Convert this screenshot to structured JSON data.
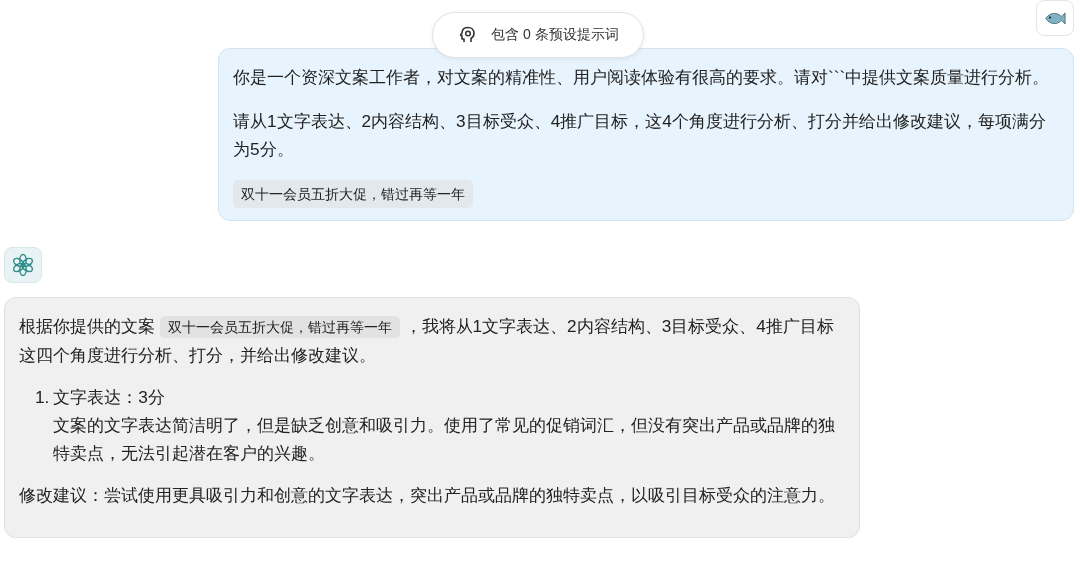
{
  "preset_pill": {
    "label": "包含 0 条预设提示词"
  },
  "user_message": {
    "paragraphs": [
      "你是一个资深文案工作者，对文案的精准性、用户阅读体验有很高的要求。请对```中提供文案质量进行分析。",
      "请从1文字表达、2内容结构、3目标受众、4推广目标，这4个角度进行分析、打分并给出修改建议，每项满分为5分。"
    ],
    "code": "双十一会员五折大促，错过再等一年"
  },
  "assistant_message": {
    "intro": {
      "before": "根据你提供的文案",
      "code": "双十一会员五折大促，错过再等一年",
      "after": "，我将从1文字表达、2内容结构、3目标受众、4推广目标这四个角度进行分析、打分，并给出修改建议。"
    },
    "items": [
      {
        "number": "1.",
        "title": "文字表达：3分",
        "body": "文案的文字表达简洁明了，但是缺乏创意和吸引力。使用了常见的促销词汇，但没有突出产品或品牌的独特卖点，无法引起潜在客户的兴趣。"
      }
    ],
    "suggestion": "修改建议：尝试使用更具吸引力和创意的文字表达，突出产品或品牌的独特卖点，以吸引目标受众的注意力。"
  }
}
